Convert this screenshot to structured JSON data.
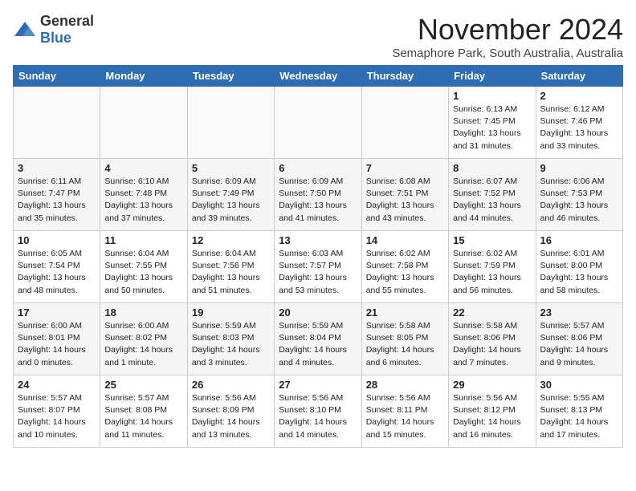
{
  "header": {
    "logo_general": "General",
    "logo_blue": "Blue",
    "title": "November 2024",
    "subtitle": "Semaphore Park, South Australia, Australia"
  },
  "columns": [
    "Sunday",
    "Monday",
    "Tuesday",
    "Wednesday",
    "Thursday",
    "Friday",
    "Saturday"
  ],
  "weeks": [
    [
      {
        "day": "",
        "info": ""
      },
      {
        "day": "",
        "info": ""
      },
      {
        "day": "",
        "info": ""
      },
      {
        "day": "",
        "info": ""
      },
      {
        "day": "",
        "info": ""
      },
      {
        "day": "1",
        "info": "Sunrise: 6:13 AM\nSunset: 7:45 PM\nDaylight: 13 hours\nand 31 minutes."
      },
      {
        "day": "2",
        "info": "Sunrise: 6:12 AM\nSunset: 7:46 PM\nDaylight: 13 hours\nand 33 minutes."
      }
    ],
    [
      {
        "day": "3",
        "info": "Sunrise: 6:11 AM\nSunset: 7:47 PM\nDaylight: 13 hours\nand 35 minutes."
      },
      {
        "day": "4",
        "info": "Sunrise: 6:10 AM\nSunset: 7:48 PM\nDaylight: 13 hours\nand 37 minutes."
      },
      {
        "day": "5",
        "info": "Sunrise: 6:09 AM\nSunset: 7:49 PM\nDaylight: 13 hours\nand 39 minutes."
      },
      {
        "day": "6",
        "info": "Sunrise: 6:09 AM\nSunset: 7:50 PM\nDaylight: 13 hours\nand 41 minutes."
      },
      {
        "day": "7",
        "info": "Sunrise: 6:08 AM\nSunset: 7:51 PM\nDaylight: 13 hours\nand 43 minutes."
      },
      {
        "day": "8",
        "info": "Sunrise: 6:07 AM\nSunset: 7:52 PM\nDaylight: 13 hours\nand 44 minutes."
      },
      {
        "day": "9",
        "info": "Sunrise: 6:06 AM\nSunset: 7:53 PM\nDaylight: 13 hours\nand 46 minutes."
      }
    ],
    [
      {
        "day": "10",
        "info": "Sunrise: 6:05 AM\nSunset: 7:54 PM\nDaylight: 13 hours\nand 48 minutes."
      },
      {
        "day": "11",
        "info": "Sunrise: 6:04 AM\nSunset: 7:55 PM\nDaylight: 13 hours\nand 50 minutes."
      },
      {
        "day": "12",
        "info": "Sunrise: 6:04 AM\nSunset: 7:56 PM\nDaylight: 13 hours\nand 51 minutes."
      },
      {
        "day": "13",
        "info": "Sunrise: 6:03 AM\nSunset: 7:57 PM\nDaylight: 13 hours\nand 53 minutes."
      },
      {
        "day": "14",
        "info": "Sunrise: 6:02 AM\nSunset: 7:58 PM\nDaylight: 13 hours\nand 55 minutes."
      },
      {
        "day": "15",
        "info": "Sunrise: 6:02 AM\nSunset: 7:59 PM\nDaylight: 13 hours\nand 56 minutes."
      },
      {
        "day": "16",
        "info": "Sunrise: 6:01 AM\nSunset: 8:00 PM\nDaylight: 13 hours\nand 58 minutes."
      }
    ],
    [
      {
        "day": "17",
        "info": "Sunrise: 6:00 AM\nSunset: 8:01 PM\nDaylight: 14 hours\nand 0 minutes."
      },
      {
        "day": "18",
        "info": "Sunrise: 6:00 AM\nSunset: 8:02 PM\nDaylight: 14 hours\nand 1 minute."
      },
      {
        "day": "19",
        "info": "Sunrise: 5:59 AM\nSunset: 8:03 PM\nDaylight: 14 hours\nand 3 minutes."
      },
      {
        "day": "20",
        "info": "Sunrise: 5:59 AM\nSunset: 8:04 PM\nDaylight: 14 hours\nand 4 minutes."
      },
      {
        "day": "21",
        "info": "Sunrise: 5:58 AM\nSunset: 8:05 PM\nDaylight: 14 hours\nand 6 minutes."
      },
      {
        "day": "22",
        "info": "Sunrise: 5:58 AM\nSunset: 8:06 PM\nDaylight: 14 hours\nand 7 minutes."
      },
      {
        "day": "23",
        "info": "Sunrise: 5:57 AM\nSunset: 8:06 PM\nDaylight: 14 hours\nand 9 minutes."
      }
    ],
    [
      {
        "day": "24",
        "info": "Sunrise: 5:57 AM\nSunset: 8:07 PM\nDaylight: 14 hours\nand 10 minutes."
      },
      {
        "day": "25",
        "info": "Sunrise: 5:57 AM\nSunset: 8:08 PM\nDaylight: 14 hours\nand 11 minutes."
      },
      {
        "day": "26",
        "info": "Sunrise: 5:56 AM\nSunset: 8:09 PM\nDaylight: 14 hours\nand 13 minutes."
      },
      {
        "day": "27",
        "info": "Sunrise: 5:56 AM\nSunset: 8:10 PM\nDaylight: 14 hours\nand 14 minutes."
      },
      {
        "day": "28",
        "info": "Sunrise: 5:56 AM\nSunset: 8:11 PM\nDaylight: 14 hours\nand 15 minutes."
      },
      {
        "day": "29",
        "info": "Sunrise: 5:56 AM\nSunset: 8:12 PM\nDaylight: 14 hours\nand 16 minutes."
      },
      {
        "day": "30",
        "info": "Sunrise: 5:55 AM\nSunset: 8:13 PM\nDaylight: 14 hours\nand 17 minutes."
      }
    ]
  ]
}
